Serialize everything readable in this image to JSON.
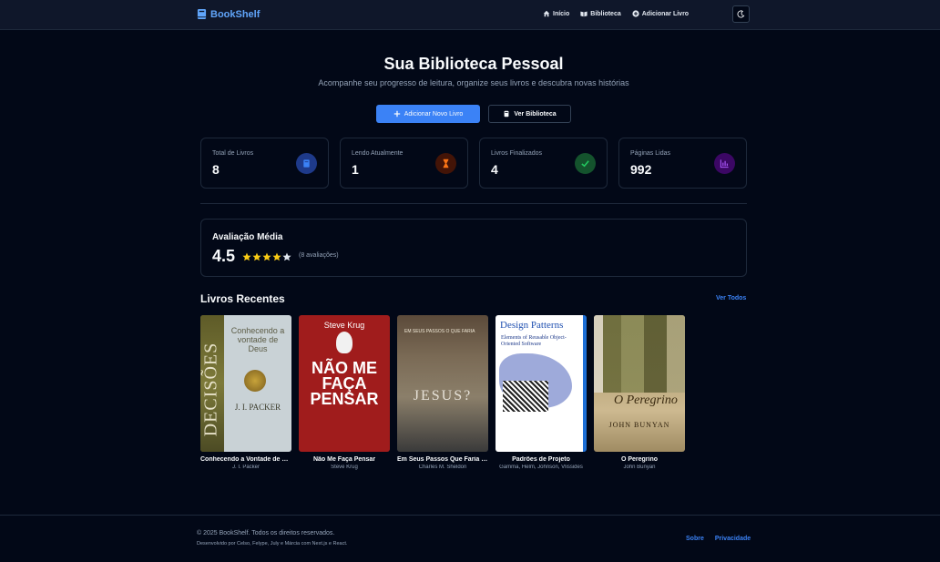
{
  "navbar": {
    "brand": "BookShelf",
    "links": [
      {
        "label": "Início",
        "icon": "home-icon"
      },
      {
        "label": "Biblioteca",
        "icon": "book-open-icon"
      },
      {
        "label": "Adicionar Livro",
        "icon": "plus-circle-icon"
      }
    ],
    "theme_icon": "moon-icon"
  },
  "hero": {
    "title": "Sua Biblioteca Pessoal",
    "subtitle": "Acompanhe seu progresso de leitura, organize seus livros e descubra novas histórias",
    "primary_button": "Adicionar Novo Livro",
    "secondary_button": "Ver Biblioteca"
  },
  "stats": [
    {
      "label": "Total de Livros",
      "value": "8",
      "icon": "book-icon",
      "color": "#3b82f6"
    },
    {
      "label": "Lendo Atualmente",
      "value": "1",
      "icon": "hourglass-icon",
      "color": "#f97316"
    },
    {
      "label": "Livros Finalizados",
      "value": "4",
      "icon": "check-icon",
      "color": "#22c55e"
    },
    {
      "label": "Páginas Lidas",
      "value": "992",
      "icon": "chart-icon",
      "color": "#a855f7"
    }
  ],
  "rating": {
    "title": "Avaliação Média",
    "value": "4.5",
    "stars": 4.5,
    "count": "(8 avaliações)"
  },
  "recent": {
    "title": "Livros Recentes",
    "see_all": "Ver Todos",
    "books": [
      {
        "title": "Conhecendo a Vontade de Deus",
        "author": "J. I. Packer",
        "cover_side": "DECISÕES",
        "cover_title": "Conhecendo a vontade de Deus",
        "cover_author": "J. I. PACKER"
      },
      {
        "title": "Não Me Faça Pensar",
        "author": "Steve Krug",
        "cover_author": "Steve Krug",
        "cover_title": "NÃO ME FAÇA PENSAR"
      },
      {
        "title": "Em Seus Passos Que Faria Jesus?",
        "author": "Charles M. Sheldon",
        "cover_title": "JESUS?",
        "cover_small": "EM SEUS PASSOS O QUE FARIA"
      },
      {
        "title": "Padrões de Projeto",
        "author": "Gamma, Helm, Johnson, Vlissides",
        "cover_title": "Design Patterns",
        "cover_sub": "Elements of Reusable Object-Oriented Software"
      },
      {
        "title": "O Peregrino",
        "author": "John Bunyan",
        "cover_title": "O Peregrino",
        "cover_author": "JOHN BUNYAN"
      }
    ]
  },
  "footer": {
    "copyright": "© 2025 BookShelf. Todos os direitos reservados.",
    "developed": "Desenvolvido por Celso, Felype, July e Márcia com Next.js e React.",
    "links": [
      "Sobre",
      "Privacidade"
    ]
  },
  "colors": {
    "accent": "#3b82f6",
    "background": "#020817",
    "star": "#facc15"
  }
}
